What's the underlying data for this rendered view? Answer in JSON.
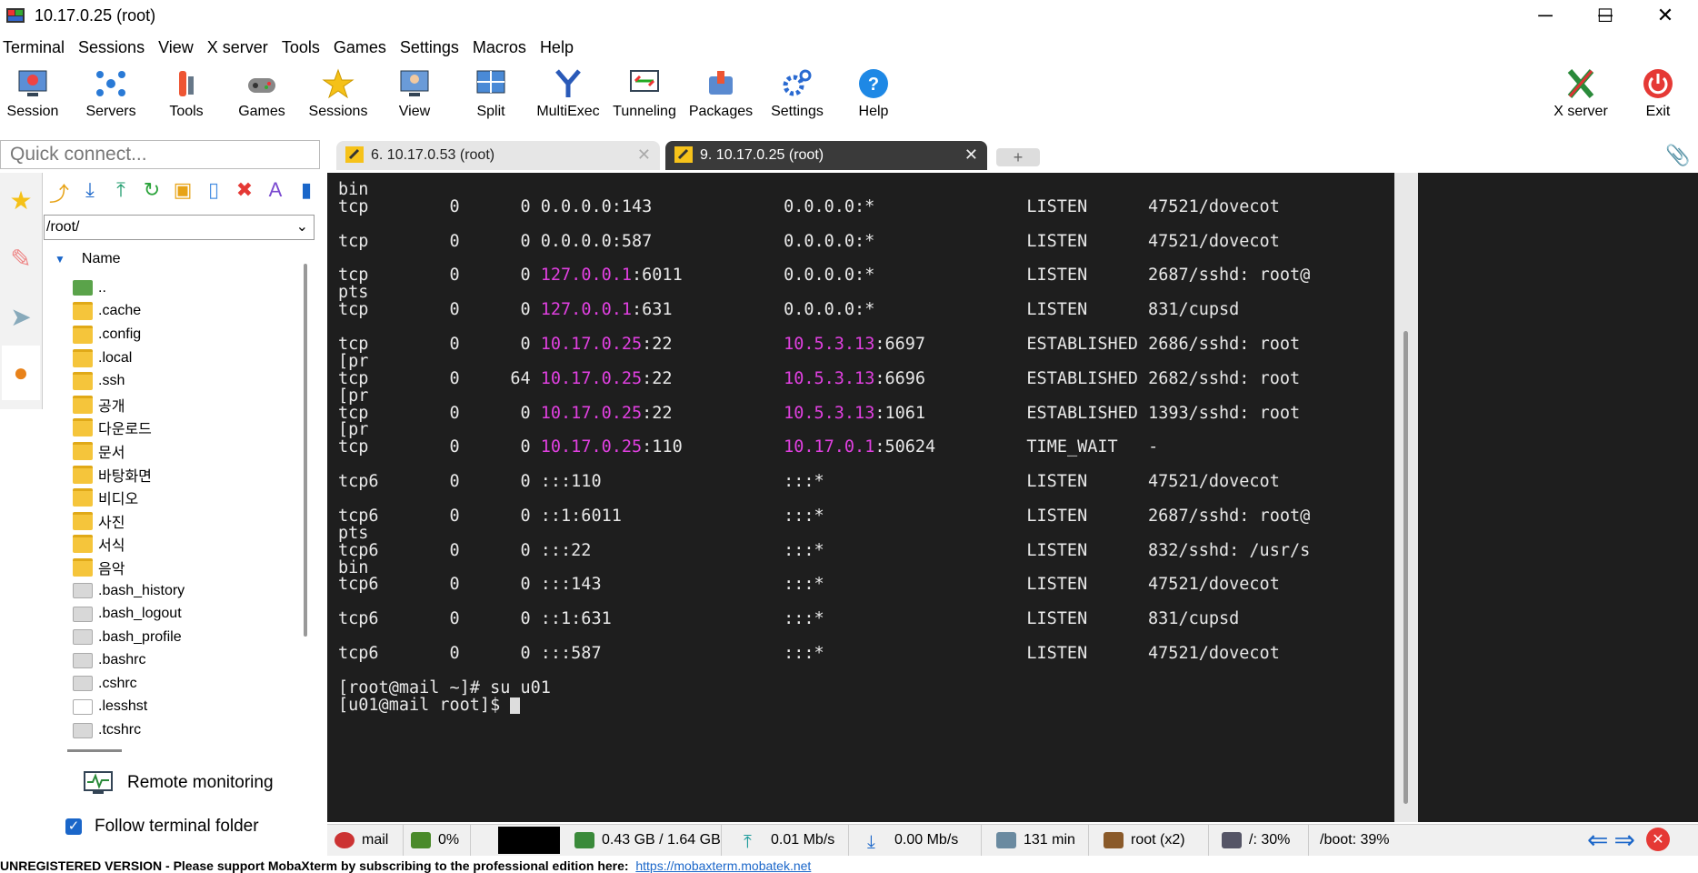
{
  "window": {
    "title": "10.17.0.25 (root)",
    "min": "─",
    "max": "☐",
    "close": "✕"
  },
  "menu": [
    "Terminal",
    "Sessions",
    "View",
    "X server",
    "Tools",
    "Games",
    "Settings",
    "Macros",
    "Help"
  ],
  "toolbar": {
    "session": "Session",
    "servers": "Servers",
    "tools": "Tools",
    "games": "Games",
    "sessions": "Sessions",
    "view": "View",
    "split": "Split",
    "multiexec": "MultiExec",
    "tunneling": "Tunneling",
    "packages": "Packages",
    "settings": "Settings",
    "help": "Help",
    "xserver": "X server",
    "exit": "Exit"
  },
  "quick_connect": {
    "placeholder": "Quick connect..."
  },
  "tabs": [
    {
      "label": "6. 10.17.0.53 (root)"
    },
    {
      "label": "9. 10.17.0.25 (root)"
    }
  ],
  "file_browser": {
    "path": "/root/",
    "column": "Name",
    "items": [
      {
        "name": "..",
        "type": "up"
      },
      {
        "name": ".cache",
        "type": "folder"
      },
      {
        "name": ".config",
        "type": "folder"
      },
      {
        "name": ".local",
        "type": "folder"
      },
      {
        "name": ".ssh",
        "type": "folder"
      },
      {
        "name": "공개",
        "type": "folder"
      },
      {
        "name": "다운로드",
        "type": "folder"
      },
      {
        "name": "문서",
        "type": "folder"
      },
      {
        "name": "바탕화면",
        "type": "folder"
      },
      {
        "name": "비디오",
        "type": "folder"
      },
      {
        "name": "사진",
        "type": "folder"
      },
      {
        "name": "서식",
        "type": "folder"
      },
      {
        "name": "음악",
        "type": "folder"
      },
      {
        "name": ".bash_history",
        "type": "file"
      },
      {
        "name": ".bash_logout",
        "type": "file"
      },
      {
        "name": ".bash_profile",
        "type": "file"
      },
      {
        "name": ".bashrc",
        "type": "file"
      },
      {
        "name": ".cshrc",
        "type": "file"
      },
      {
        "name": ".lesshst",
        "type": "filew"
      },
      {
        "name": ".tcshrc",
        "type": "file"
      }
    ],
    "remote_monitoring": "Remote monitoring",
    "follow_terminal": "Follow terminal folder"
  },
  "terminal": {
    "lines": [
      [
        {
          "t": "bin"
        }
      ],
      [
        {
          "t": "tcp        0      0 0.0.0.0:143             0.0.0.0:*               LISTEN      47521/dovecot"
        }
      ],
      [
        {
          "t": ""
        }
      ],
      [
        {
          "t": "tcp        0      0 0.0.0.0:587             0.0.0.0:*               LISTEN      47521/dovecot"
        }
      ],
      [
        {
          "t": ""
        }
      ],
      [
        {
          "t": "tcp        0      0 "
        },
        {
          "t": "127.0.0.1",
          "m": 1
        },
        {
          "t": ":6011          0.0.0.0:*               LISTEN      2687/sshd: root@"
        }
      ],
      [
        {
          "t": "pts"
        }
      ],
      [
        {
          "t": "tcp        0      0 "
        },
        {
          "t": "127.0.0.1",
          "m": 1
        },
        {
          "t": ":631           0.0.0.0:*               LISTEN      831/cupsd"
        }
      ],
      [
        {
          "t": ""
        }
      ],
      [
        {
          "t": "tcp        0      0 "
        },
        {
          "t": "10.17.0.25",
          "m": 1
        },
        {
          "t": ":22           "
        },
        {
          "t": "10.5.3.13",
          "m": 1
        },
        {
          "t": ":6697          ESTABLISHED 2686/sshd: root"
        }
      ],
      [
        {
          "t": "[pr"
        }
      ],
      [
        {
          "t": "tcp        0     64 "
        },
        {
          "t": "10.17.0.25",
          "m": 1
        },
        {
          "t": ":22           "
        },
        {
          "t": "10.5.3.13",
          "m": 1
        },
        {
          "t": ":6696          ESTABLISHED 2682/sshd: root"
        }
      ],
      [
        {
          "t": "[pr"
        }
      ],
      [
        {
          "t": "tcp        0      0 "
        },
        {
          "t": "10.17.0.25",
          "m": 1
        },
        {
          "t": ":22           "
        },
        {
          "t": "10.5.3.13",
          "m": 1
        },
        {
          "t": ":1061          ESTABLISHED 1393/sshd: root"
        }
      ],
      [
        {
          "t": "[pr"
        }
      ],
      [
        {
          "t": "tcp        0      0 "
        },
        {
          "t": "10.17.0.25",
          "m": 1
        },
        {
          "t": ":110          "
        },
        {
          "t": "10.17.0.1",
          "m": 1
        },
        {
          "t": ":50624         TIME_WAIT   -"
        }
      ],
      [
        {
          "t": ""
        }
      ],
      [
        {
          "t": "tcp6       0      0 :::110                  :::*                    LISTEN      47521/dovecot"
        }
      ],
      [
        {
          "t": ""
        }
      ],
      [
        {
          "t": "tcp6       0      0 ::1:6011                :::*                    LISTEN      2687/sshd: root@"
        }
      ],
      [
        {
          "t": "pts"
        }
      ],
      [
        {
          "t": "tcp6       0      0 :::22                   :::*                    LISTEN      832/sshd: /usr/s"
        }
      ],
      [
        {
          "t": "bin"
        }
      ],
      [
        {
          "t": "tcp6       0      0 :::143                  :::*                    LISTEN      47521/dovecot"
        }
      ],
      [
        {
          "t": ""
        }
      ],
      [
        {
          "t": "tcp6       0      0 ::1:631                 :::*                    LISTEN      831/cupsd"
        }
      ],
      [
        {
          "t": ""
        }
      ],
      [
        {
          "t": "tcp6       0      0 :::587                  :::*                    LISTEN      47521/dovecot"
        }
      ],
      [
        {
          "t": ""
        }
      ],
      [
        {
          "t": "[root@mail ~]# su u01"
        }
      ],
      [
        {
          "t": "[u01@mail root]$ "
        },
        {
          "cursor": 1
        }
      ]
    ]
  },
  "status": {
    "host": "mail",
    "cpu": "0%",
    "mem": "0.43 GB / 1.64 GB",
    "up": "0.01 Mb/s",
    "down": "0.00 Mb/s",
    "uptime": "131 min",
    "users": "root (x2)",
    "root_fs": "/: 30%",
    "boot_fs": "/boot: 39%"
  },
  "footer": {
    "text": "UNREGISTERED VERSION  -  Please support MobaXterm by subscribing to the professional edition here:",
    "link": "https://mobaxterm.mobatek.net"
  }
}
